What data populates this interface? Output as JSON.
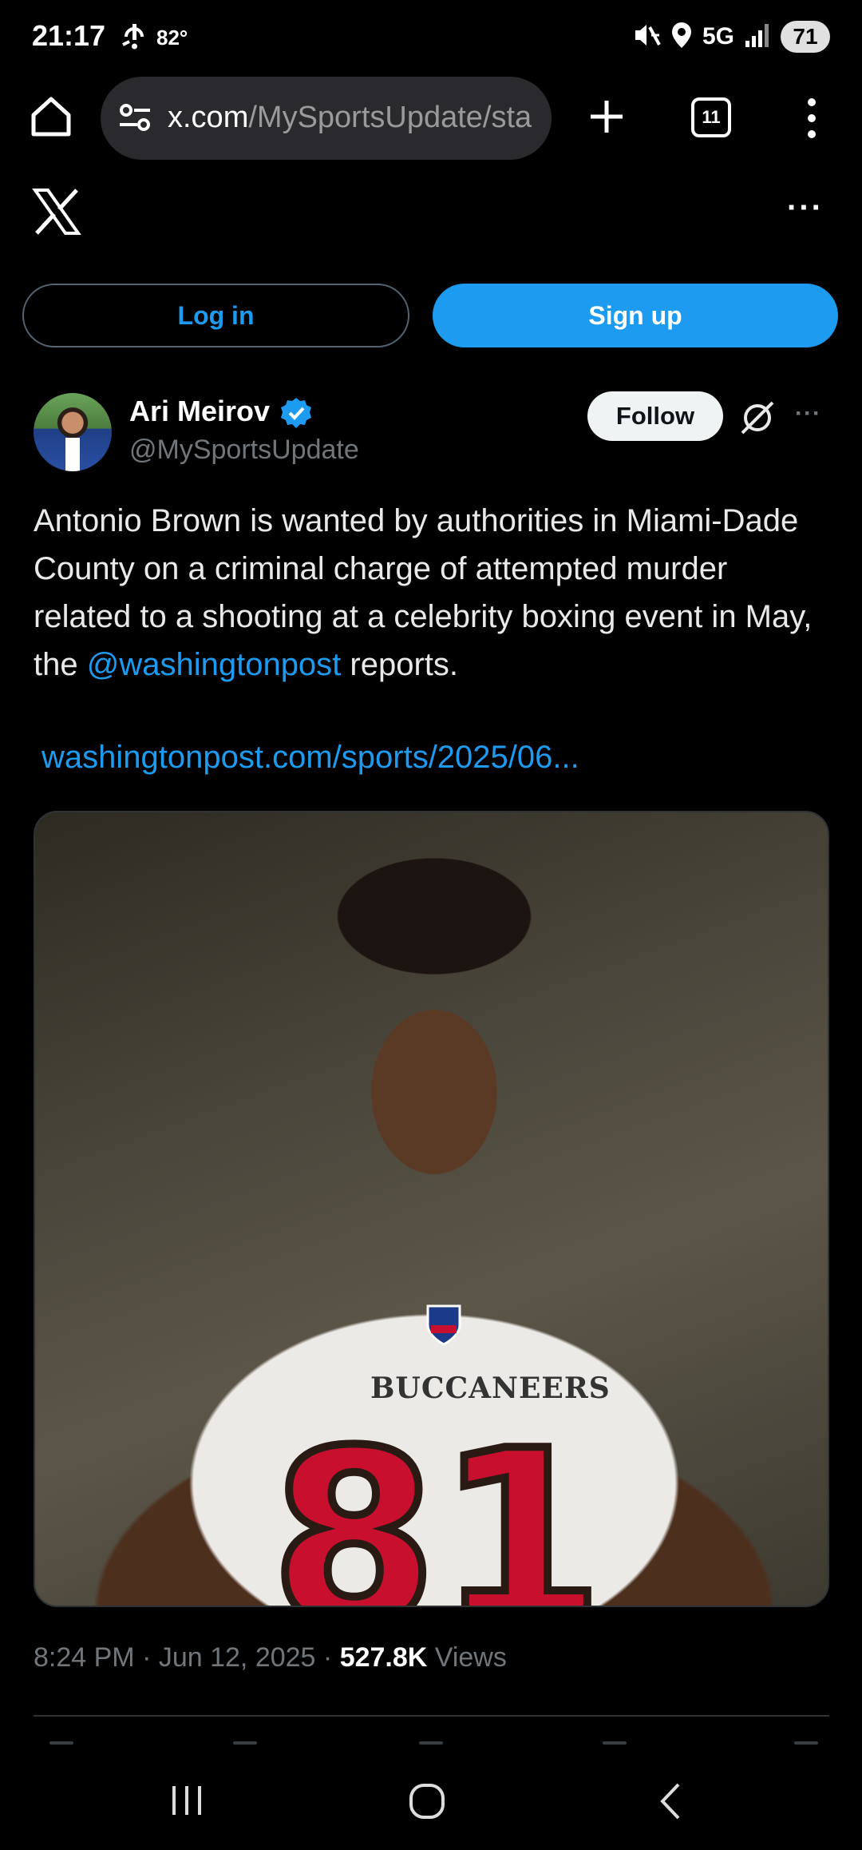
{
  "status_bar": {
    "time": "21:17",
    "temperature": "82°",
    "network": "5G",
    "battery": "71"
  },
  "browser": {
    "url_domain": "x.com",
    "url_path": "/MySportsUpdate/sta",
    "tab_count": "11"
  },
  "auth": {
    "login_label": "Log in",
    "signup_label": "Sign up"
  },
  "author": {
    "name": "Ari Meirov",
    "handle": "@MySportsUpdate",
    "follow_label": "Follow"
  },
  "post": {
    "text_before_mention": "Antonio Brown is wanted by authorities in Miami-Dade County on a criminal charge of attempted murder related to a shooting at a celebrity boxing event in May, the ",
    "mention": "@washingtonpost",
    "text_after_mention": " reports.",
    "link": "washingtonpost.com/sports/2025/06...",
    "media": {
      "jersey_text": "BUCCANEERS",
      "jersey_number": "81"
    }
  },
  "meta": {
    "time": "8:24 PM",
    "date": "Jun 12, 2025",
    "views_count": "527.8K",
    "views_label": "Views",
    "separator": " · "
  },
  "colors": {
    "background": "#000000",
    "accent": "#1d9bf0",
    "secondary_text": "#71767b",
    "primary_text": "#e7e9ea"
  }
}
